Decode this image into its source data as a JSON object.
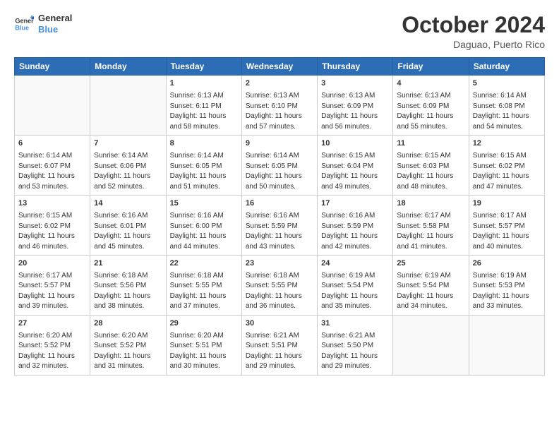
{
  "logo": {
    "line1": "General",
    "line2": "Blue"
  },
  "title": "October 2024",
  "location": "Daguao, Puerto Rico",
  "days_header": [
    "Sunday",
    "Monday",
    "Tuesday",
    "Wednesday",
    "Thursday",
    "Friday",
    "Saturday"
  ],
  "weeks": [
    [
      {
        "day": "",
        "sunrise": "",
        "sunset": "",
        "daylight": ""
      },
      {
        "day": "",
        "sunrise": "",
        "sunset": "",
        "daylight": ""
      },
      {
        "day": "1",
        "sunrise": "Sunrise: 6:13 AM",
        "sunset": "Sunset: 6:11 PM",
        "daylight": "Daylight: 11 hours and 58 minutes."
      },
      {
        "day": "2",
        "sunrise": "Sunrise: 6:13 AM",
        "sunset": "Sunset: 6:10 PM",
        "daylight": "Daylight: 11 hours and 57 minutes."
      },
      {
        "day": "3",
        "sunrise": "Sunrise: 6:13 AM",
        "sunset": "Sunset: 6:09 PM",
        "daylight": "Daylight: 11 hours and 56 minutes."
      },
      {
        "day": "4",
        "sunrise": "Sunrise: 6:13 AM",
        "sunset": "Sunset: 6:09 PM",
        "daylight": "Daylight: 11 hours and 55 minutes."
      },
      {
        "day": "5",
        "sunrise": "Sunrise: 6:14 AM",
        "sunset": "Sunset: 6:08 PM",
        "daylight": "Daylight: 11 hours and 54 minutes."
      }
    ],
    [
      {
        "day": "6",
        "sunrise": "Sunrise: 6:14 AM",
        "sunset": "Sunset: 6:07 PM",
        "daylight": "Daylight: 11 hours and 53 minutes."
      },
      {
        "day": "7",
        "sunrise": "Sunrise: 6:14 AM",
        "sunset": "Sunset: 6:06 PM",
        "daylight": "Daylight: 11 hours and 52 minutes."
      },
      {
        "day": "8",
        "sunrise": "Sunrise: 6:14 AM",
        "sunset": "Sunset: 6:05 PM",
        "daylight": "Daylight: 11 hours and 51 minutes."
      },
      {
        "day": "9",
        "sunrise": "Sunrise: 6:14 AM",
        "sunset": "Sunset: 6:05 PM",
        "daylight": "Daylight: 11 hours and 50 minutes."
      },
      {
        "day": "10",
        "sunrise": "Sunrise: 6:15 AM",
        "sunset": "Sunset: 6:04 PM",
        "daylight": "Daylight: 11 hours and 49 minutes."
      },
      {
        "day": "11",
        "sunrise": "Sunrise: 6:15 AM",
        "sunset": "Sunset: 6:03 PM",
        "daylight": "Daylight: 11 hours and 48 minutes."
      },
      {
        "day": "12",
        "sunrise": "Sunrise: 6:15 AM",
        "sunset": "Sunset: 6:02 PM",
        "daylight": "Daylight: 11 hours and 47 minutes."
      }
    ],
    [
      {
        "day": "13",
        "sunrise": "Sunrise: 6:15 AM",
        "sunset": "Sunset: 6:02 PM",
        "daylight": "Daylight: 11 hours and 46 minutes."
      },
      {
        "day": "14",
        "sunrise": "Sunrise: 6:16 AM",
        "sunset": "Sunset: 6:01 PM",
        "daylight": "Daylight: 11 hours and 45 minutes."
      },
      {
        "day": "15",
        "sunrise": "Sunrise: 6:16 AM",
        "sunset": "Sunset: 6:00 PM",
        "daylight": "Daylight: 11 hours and 44 minutes."
      },
      {
        "day": "16",
        "sunrise": "Sunrise: 6:16 AM",
        "sunset": "Sunset: 5:59 PM",
        "daylight": "Daylight: 11 hours and 43 minutes."
      },
      {
        "day": "17",
        "sunrise": "Sunrise: 6:16 AM",
        "sunset": "Sunset: 5:59 PM",
        "daylight": "Daylight: 11 hours and 42 minutes."
      },
      {
        "day": "18",
        "sunrise": "Sunrise: 6:17 AM",
        "sunset": "Sunset: 5:58 PM",
        "daylight": "Daylight: 11 hours and 41 minutes."
      },
      {
        "day": "19",
        "sunrise": "Sunrise: 6:17 AM",
        "sunset": "Sunset: 5:57 PM",
        "daylight": "Daylight: 11 hours and 40 minutes."
      }
    ],
    [
      {
        "day": "20",
        "sunrise": "Sunrise: 6:17 AM",
        "sunset": "Sunset: 5:57 PM",
        "daylight": "Daylight: 11 hours and 39 minutes."
      },
      {
        "day": "21",
        "sunrise": "Sunrise: 6:18 AM",
        "sunset": "Sunset: 5:56 PM",
        "daylight": "Daylight: 11 hours and 38 minutes."
      },
      {
        "day": "22",
        "sunrise": "Sunrise: 6:18 AM",
        "sunset": "Sunset: 5:55 PM",
        "daylight": "Daylight: 11 hours and 37 minutes."
      },
      {
        "day": "23",
        "sunrise": "Sunrise: 6:18 AM",
        "sunset": "Sunset: 5:55 PM",
        "daylight": "Daylight: 11 hours and 36 minutes."
      },
      {
        "day": "24",
        "sunrise": "Sunrise: 6:19 AM",
        "sunset": "Sunset: 5:54 PM",
        "daylight": "Daylight: 11 hours and 35 minutes."
      },
      {
        "day": "25",
        "sunrise": "Sunrise: 6:19 AM",
        "sunset": "Sunset: 5:54 PM",
        "daylight": "Daylight: 11 hours and 34 minutes."
      },
      {
        "day": "26",
        "sunrise": "Sunrise: 6:19 AM",
        "sunset": "Sunset: 5:53 PM",
        "daylight": "Daylight: 11 hours and 33 minutes."
      }
    ],
    [
      {
        "day": "27",
        "sunrise": "Sunrise: 6:20 AM",
        "sunset": "Sunset: 5:52 PM",
        "daylight": "Daylight: 11 hours and 32 minutes."
      },
      {
        "day": "28",
        "sunrise": "Sunrise: 6:20 AM",
        "sunset": "Sunset: 5:52 PM",
        "daylight": "Daylight: 11 hours and 31 minutes."
      },
      {
        "day": "29",
        "sunrise": "Sunrise: 6:20 AM",
        "sunset": "Sunset: 5:51 PM",
        "daylight": "Daylight: 11 hours and 30 minutes."
      },
      {
        "day": "30",
        "sunrise": "Sunrise: 6:21 AM",
        "sunset": "Sunset: 5:51 PM",
        "daylight": "Daylight: 11 hours and 29 minutes."
      },
      {
        "day": "31",
        "sunrise": "Sunrise: 6:21 AM",
        "sunset": "Sunset: 5:50 PM",
        "daylight": "Daylight: 11 hours and 29 minutes."
      },
      {
        "day": "",
        "sunrise": "",
        "sunset": "",
        "daylight": ""
      },
      {
        "day": "",
        "sunrise": "",
        "sunset": "",
        "daylight": ""
      }
    ]
  ]
}
